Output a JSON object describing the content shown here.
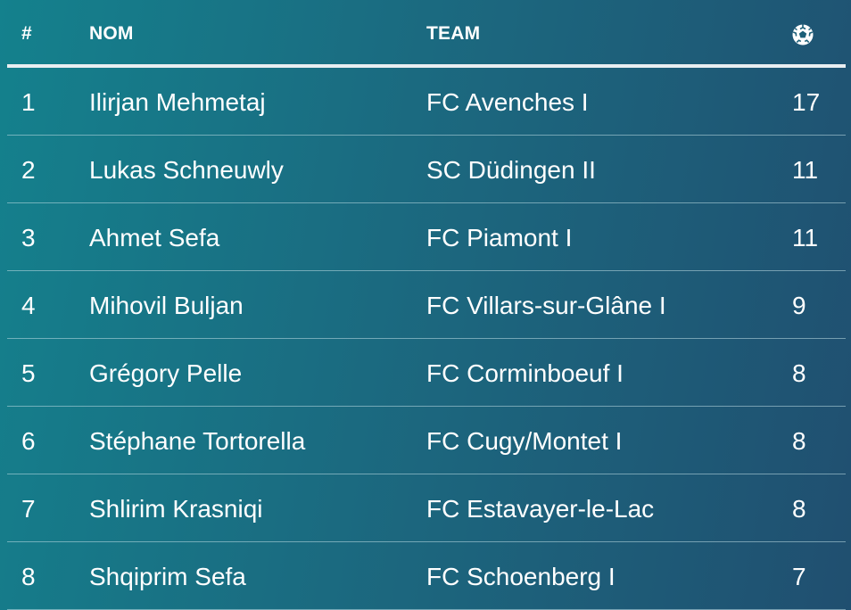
{
  "header": {
    "rank": "#",
    "name": "NOM",
    "team": "TEAM",
    "goals_icon": "soccer-ball-icon"
  },
  "rows": [
    {
      "rank": "1",
      "name": "Ilirjan Mehmetaj",
      "team": "FC Avenches I",
      "goals": "17"
    },
    {
      "rank": "2",
      "name": "Lukas Schneuwly",
      "team": "SC Düdingen II",
      "goals": "11"
    },
    {
      "rank": "3",
      "name": "Ahmet Sefa",
      "team": "FC Piamont I",
      "goals": "11"
    },
    {
      "rank": "4",
      "name": "Mihovil Buljan",
      "team": "FC Villars-sur-Glâne I",
      "goals": "9"
    },
    {
      "rank": "5",
      "name": "Grégory Pelle",
      "team": "FC Corminboeuf I",
      "goals": "8"
    },
    {
      "rank": "6",
      "name": "Stéphane Tortorella",
      "team": "FC Cugy/Montet I",
      "goals": "8"
    },
    {
      "rank": "7",
      "name": "Shlirim Krasniqi",
      "team": "FC Estavayer-le-Lac",
      "goals": "8"
    },
    {
      "rank": "8",
      "name": "Shqiprim Sefa",
      "team": "FC Schoenberg I",
      "goals": "7"
    }
  ],
  "colors": {
    "background_start": "#14818d",
    "background_end": "#204f70",
    "text": "#ffffff"
  }
}
